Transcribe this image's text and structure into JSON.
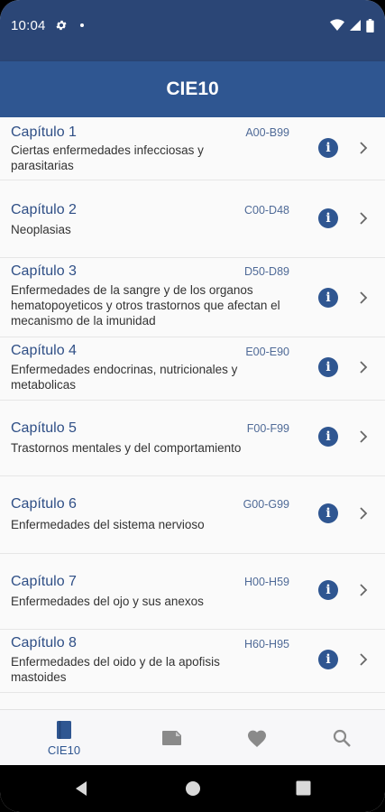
{
  "status": {
    "time": "10:04"
  },
  "app_bar": {
    "title": "CIE10"
  },
  "chapters": [
    {
      "title": "Capítulo 1",
      "code": "A00-B99",
      "desc": "Ciertas enfermedades infecciosas y parasitarias"
    },
    {
      "title": "Capítulo 2",
      "code": "C00-D48",
      "desc": "Neoplasias"
    },
    {
      "title": "Capítulo 3",
      "code": "D50-D89",
      "desc": "Enfermedades de la sangre y de los organos hematopoyeticos y otros trastornos que afectan el mecanismo de la imunidad"
    },
    {
      "title": "Capítulo 4",
      "code": "E00-E90",
      "desc": "Enfermedades endocrinas, nutricionales y metabolicas"
    },
    {
      "title": "Capítulo 5",
      "code": "F00-F99",
      "desc": "Trastornos mentales y del comportamiento"
    },
    {
      "title": "Capítulo 6",
      "code": "G00-G99",
      "desc": "Enfermedades del sistema nervioso"
    },
    {
      "title": "Capítulo 7",
      "code": "H00-H59",
      "desc": "Enfermedades del ojo y sus anexos"
    },
    {
      "title": "Capítulo 8",
      "code": "H60-H95",
      "desc": "Enfermedades del oido y de la apofisis mastoides"
    }
  ],
  "bottom_nav": {
    "items": [
      {
        "label": "CIE10",
        "icon": "book-icon",
        "active": true
      },
      {
        "label": "",
        "icon": "label-icon",
        "active": false
      },
      {
        "label": "",
        "icon": "heart-icon",
        "active": false
      },
      {
        "label": "",
        "icon": "search-icon",
        "active": false
      }
    ]
  },
  "colors": {
    "primary": "#2f5691",
    "status_bar": "#2b4676",
    "title_text": "#2f4f86"
  }
}
